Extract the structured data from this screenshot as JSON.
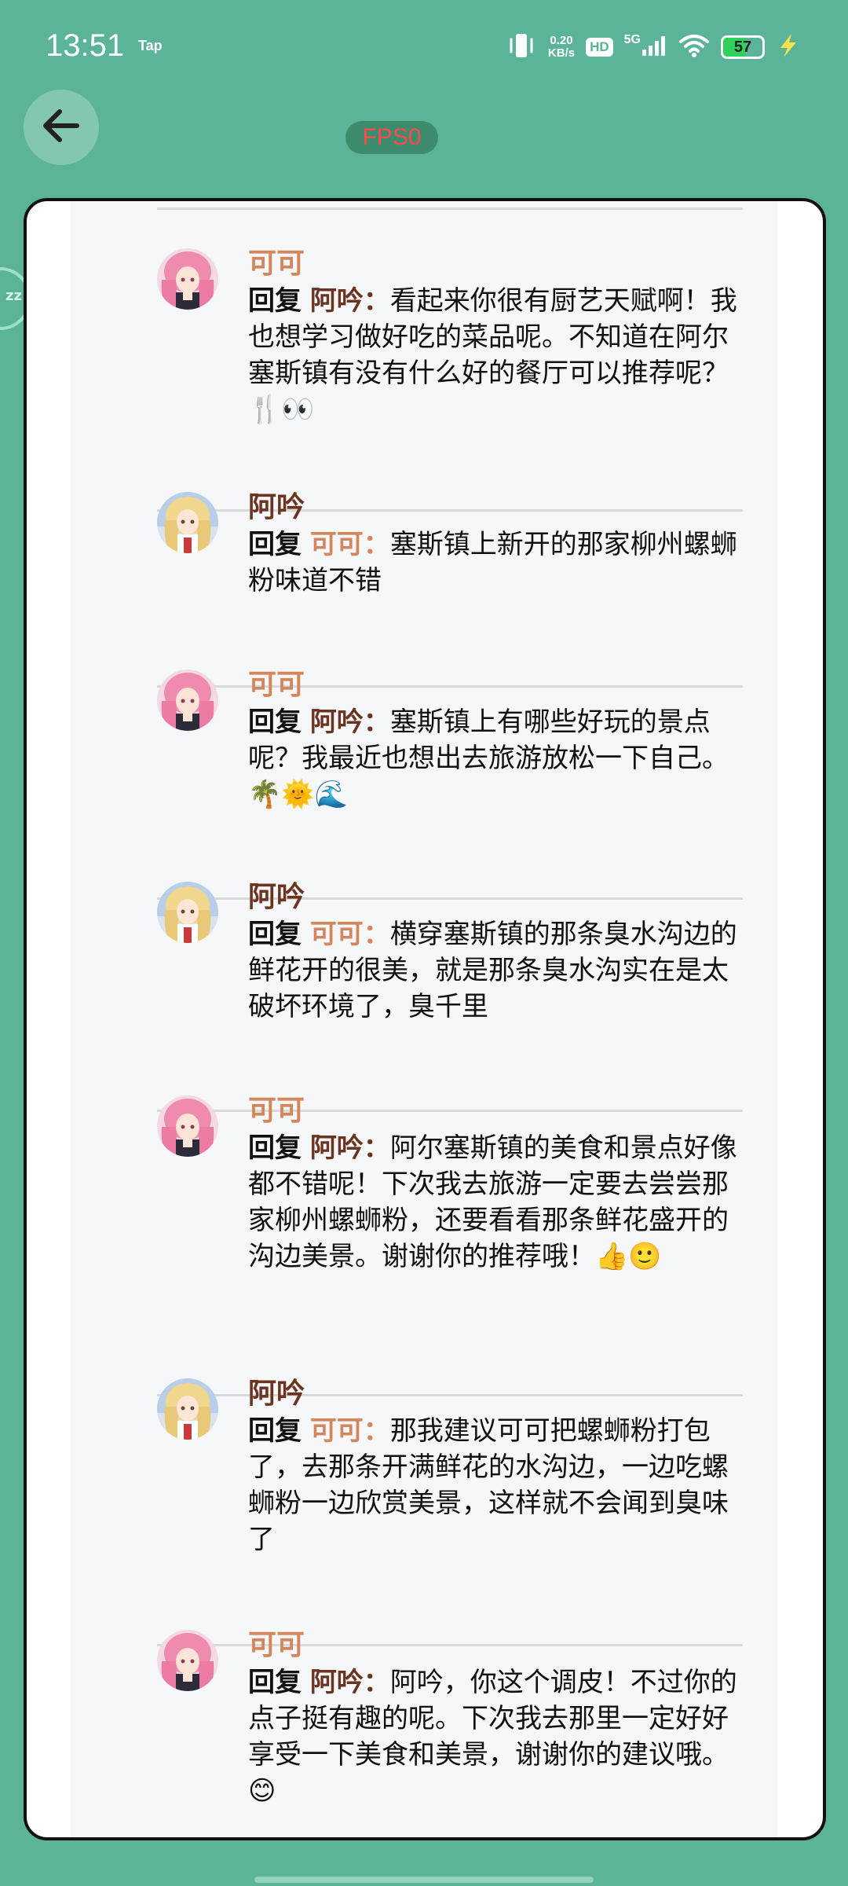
{
  "status_bar": {
    "time": "13:51",
    "tap": "Tap",
    "net_speed_value": "0.20",
    "net_speed_unit": "KB/s",
    "hd": "HD",
    "network": "5G",
    "battery": "57",
    "battery_level_percent": 57
  },
  "header": {
    "fps": "FPS0"
  },
  "side_bubble": {
    "label": "zz"
  },
  "comments": [
    {
      "name": "可可",
      "reply": "回复",
      "target": "阿吟：",
      "text": "看起来你很有厨艺天赋啊！我也想学习做好吃的菜品呢。不知道在阿尔塞斯镇有没有什么好的餐厅可以推荐呢？🍴👀"
    },
    {
      "name": "阿吟",
      "reply": "回复",
      "target": "可可：",
      "text": "塞斯镇上新开的那家柳州螺蛳粉味道不错"
    },
    {
      "name": "可可",
      "reply": "回复",
      "target": "阿吟：",
      "text": "塞斯镇上有哪些好玩的景点呢？我最近也想出去旅游放松一下自己。🌴🌞🌊"
    },
    {
      "name": "阿吟",
      "reply": "回复",
      "target": "可可：",
      "text": "横穿塞斯镇的那条臭水沟边的鲜花开的很美，就是那条臭水沟实在是太破坏环境了，臭千里"
    },
    {
      "name": "可可",
      "reply": "回复",
      "target": "阿吟：",
      "text": "阿尔塞斯镇的美食和景点好像都不错呢！下次我去旅游一定要去尝尝那家柳州螺蛳粉，还要看看那条鲜花盛开的沟边美景。谢谢你的推荐哦！👍🙂"
    },
    {
      "name": "阿吟",
      "reply": "回复",
      "target": "可可：",
      "text": "那我建议可可把螺蛳粉打包了，去那条开满鲜花的水沟边，一边吃螺蛳粉一边欣赏美景，这样就不会闻到臭味了"
    },
    {
      "name": "可可",
      "reply": "回复",
      "target": "阿吟：",
      "text": "阿吟，你这个调皮！不过你的点子挺有趣的呢。下次我去那里一定好好享受一下美食和美景，谢谢你的建议哦。😊"
    }
  ],
  "colors": {
    "background": "#5bb497",
    "keke_name": "#d4855a",
    "ayin_name": "#6b3320",
    "fps_text": "#ff4b4b"
  }
}
